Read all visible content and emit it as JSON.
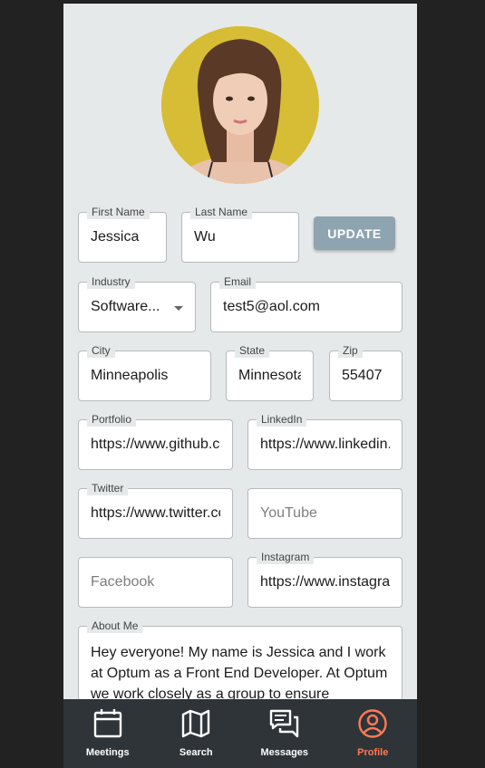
{
  "profile": {
    "avatar_alt": "Profile photo",
    "update_label": "UPDATE",
    "fields": {
      "first_name": {
        "label": "First Name",
        "value": "Jessica"
      },
      "last_name": {
        "label": "Last Name",
        "value": "Wu"
      },
      "industry": {
        "label": "Industry",
        "value": "Software..."
      },
      "email": {
        "label": "Email",
        "value": "test5@aol.com"
      },
      "city": {
        "label": "City",
        "value": "Minneapolis"
      },
      "state": {
        "label": "State",
        "value": "Minnesota"
      },
      "zip": {
        "label": "Zip",
        "value": "55407"
      },
      "portfolio": {
        "label": "Portfolio",
        "value": "https://www.github.com"
      },
      "linkedin": {
        "label": "LinkedIn",
        "value": "https://www.linkedin.com"
      },
      "twitter": {
        "label": "Twitter",
        "value": "https://www.twitter.com"
      },
      "youtube": {
        "placeholder": "YouTube"
      },
      "facebook": {
        "placeholder": "Facebook"
      },
      "instagram": {
        "label": "Instagram",
        "value": "https://www.instagram.com"
      }
    },
    "about": {
      "label": "About Me",
      "value": "Hey everyone! My name is Jessica and I work at Optum as a Front End Developer. At Optum we work closely as a group to ensure"
    }
  },
  "tabbar": {
    "tabs": [
      {
        "label": "Meetings",
        "icon": "calendar-icon"
      },
      {
        "label": "Search",
        "icon": "map-icon"
      },
      {
        "label": "Messages",
        "icon": "chat-icon"
      },
      {
        "label": "Profile",
        "icon": "user-circle-icon",
        "active": true
      }
    ]
  },
  "colors": {
    "background": "#222222",
    "panel": "#e6e9ea",
    "update_button": "#8fa4b1",
    "tabbar": "#2e3438",
    "active_tab": "#ff7a57"
  }
}
